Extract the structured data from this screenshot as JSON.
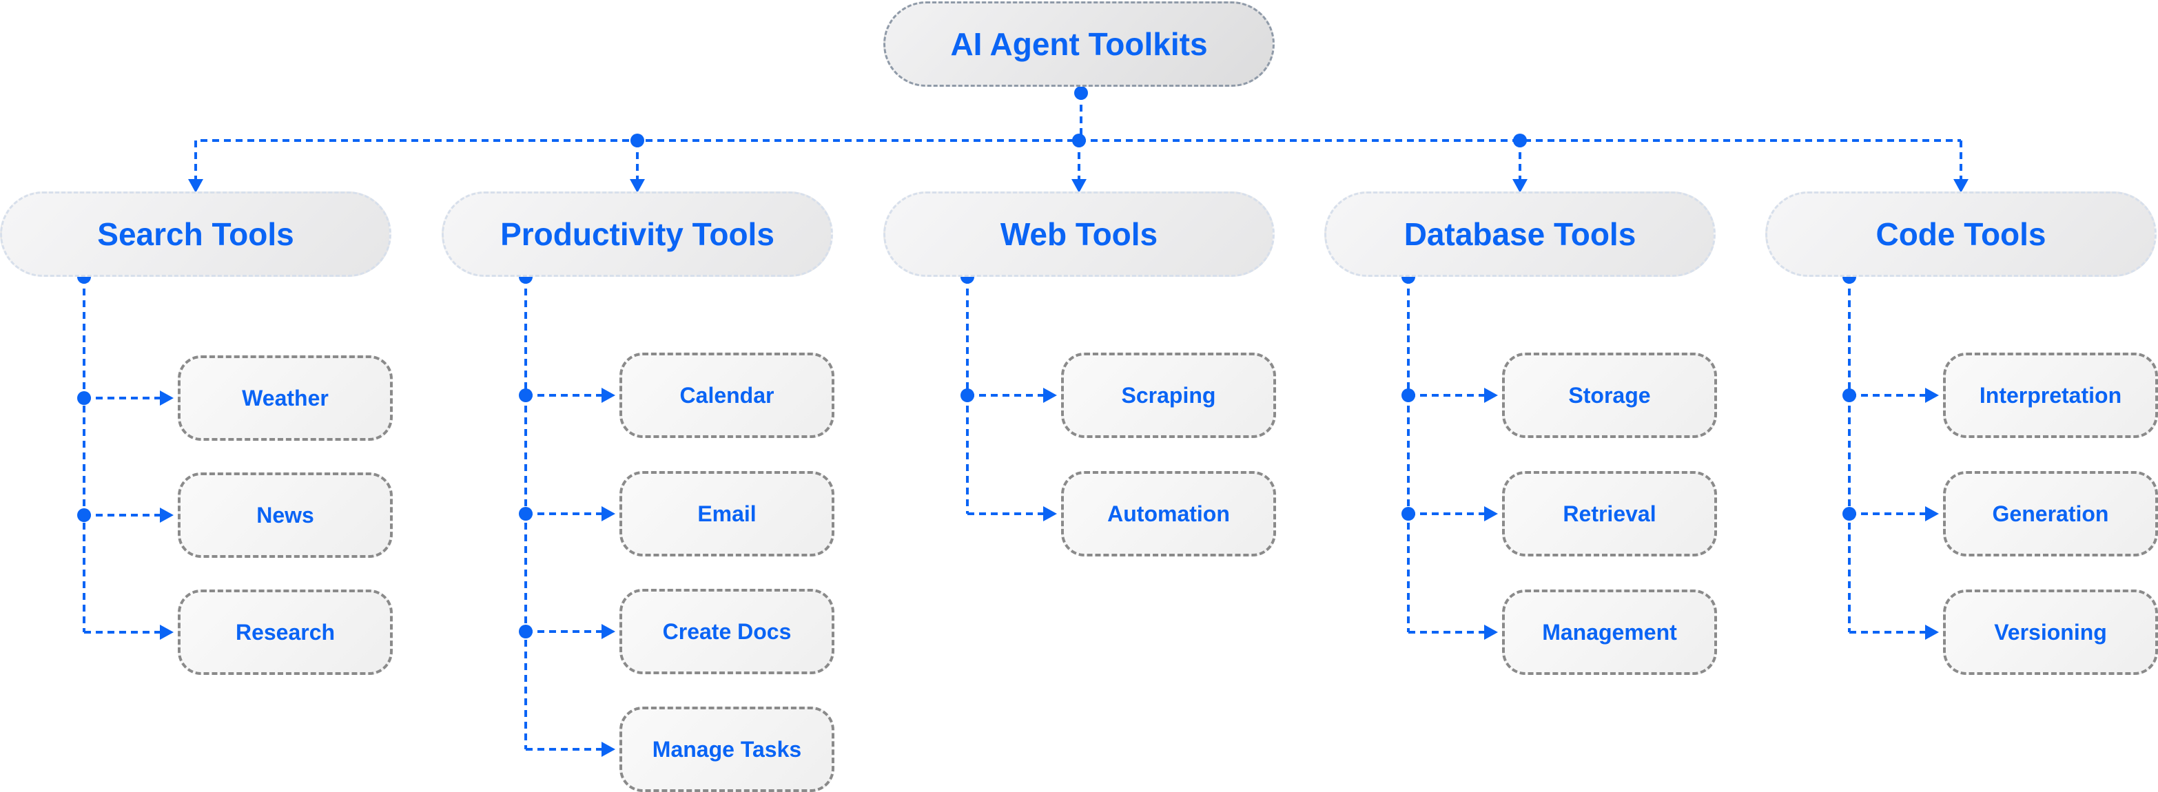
{
  "diagram": {
    "root": {
      "label": "AI Agent Toolkits"
    },
    "accent_color": "#0A64F5",
    "categories": [
      {
        "label": "Search Tools",
        "children": [
          "Weather",
          "News",
          "Research"
        ]
      },
      {
        "label": "Productivity Tools",
        "children": [
          "Calendar",
          "Email",
          "Create Docs",
          "Manage Tasks"
        ]
      },
      {
        "label": "Web Tools",
        "children": [
          "Scraping",
          "Automation"
        ]
      },
      {
        "label": "Database Tools",
        "children": [
          "Storage",
          "Retrieval",
          "Management"
        ]
      },
      {
        "label": "Code Tools",
        "children": [
          "Interpretation",
          "Generation",
          "Versioning"
        ]
      }
    ]
  }
}
